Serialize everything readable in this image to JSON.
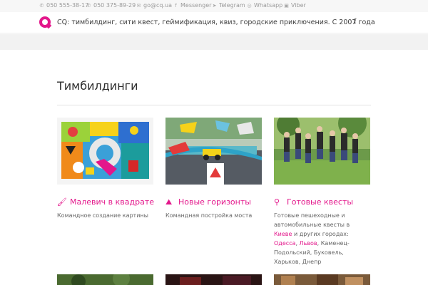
{
  "topbar": {
    "phone1": "050 555-38-17",
    "phone2": "050 375-89-29",
    "email": "go@cq.ua",
    "messenger": "Messenger",
    "telegram": "Telegram",
    "whatsapp": "Whatsapp",
    "viber": "Viber"
  },
  "header": {
    "title": "CQ: тимбилдинг, сити квест, геймификация, квиз, городские приключения. С 2007 года",
    "fb": "f"
  },
  "section": {
    "title": "Тимбилдинги"
  },
  "cards": [
    {
      "title": "Малевич в квадрате",
      "desc": "Командное создание картины",
      "icon": "brush-icon"
    },
    {
      "title": "Новые горизонты",
      "desc": "Командная постройка моста",
      "icon": "road-icon"
    },
    {
      "title": "Готовые квесты",
      "icon": "map-marker-icon",
      "desc_line1": "Готовые пешеходные и автомобильные квесты в",
      "desc_link1": "Киеве",
      "desc_line1b": "и других городах:",
      "desc_link2": "Одесса",
      "desc_link3": "Львов",
      "desc_line2": "Каменец-Подольский, Буковель, Харьков, Днепр"
    }
  ],
  "colors": {
    "accent": "#e3178b",
    "text": "#333333",
    "muted": "#9a9a9a"
  }
}
